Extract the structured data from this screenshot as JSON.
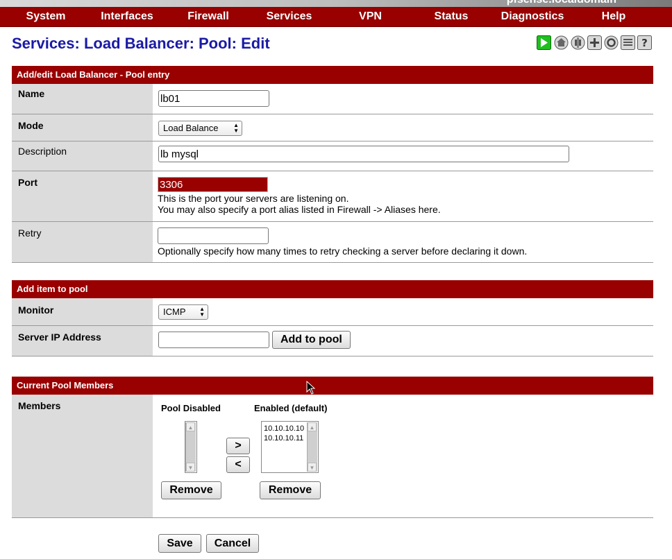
{
  "header": {
    "hostname": "pfsense.localdomain"
  },
  "nav": {
    "items": [
      "System",
      "Interfaces",
      "Firewall",
      "Services",
      "VPN",
      "Status",
      "Diagnostics",
      "Help"
    ]
  },
  "page": {
    "title": "Services: Load Balancer: Pool: Edit"
  },
  "toolbar": {
    "icons": [
      "play-icon",
      "home-icon",
      "globe-icon",
      "add-icon",
      "settings-icon",
      "log-icon",
      "help-icon"
    ]
  },
  "pool_entry": {
    "heading": "Add/edit Load Balancer - Pool entry",
    "name_label": "Name",
    "name_value": "lb01",
    "mode_label": "Mode",
    "mode_value": "Load Balance",
    "description_label": "Description",
    "description_value": "lb mysql",
    "port_label": "Port",
    "port_value": "3306",
    "port_help1": "This is the port your servers are listening on.",
    "port_help2": "You may also specify a port alias listed in Firewall -> Aliases here.",
    "retry_label": "Retry",
    "retry_value": "",
    "retry_help": "Optionally specify how many times to retry checking a server before declaring it down."
  },
  "add_item": {
    "heading": "Add item to pool",
    "monitor_label": "Monitor",
    "monitor_value": "ICMP",
    "server_ip_label": "Server IP Address",
    "server_ip_value": "",
    "add_button": "Add to pool"
  },
  "members": {
    "heading": "Current Pool Members",
    "label": "Members",
    "disabled_title": "Pool Disabled",
    "enabled_title": "Enabled (default)",
    "disabled_list": [],
    "enabled_list": [
      "10.10.10.10",
      "10.10.10.11"
    ],
    "move_right": ">",
    "move_left": "<",
    "remove_disabled": "Remove",
    "remove_enabled": "Remove"
  },
  "actions": {
    "save": "Save",
    "cancel": "Cancel"
  },
  "colors": {
    "brand": "#990000",
    "title": "#1a1aa6",
    "label_bg": "#dcdcdc"
  }
}
